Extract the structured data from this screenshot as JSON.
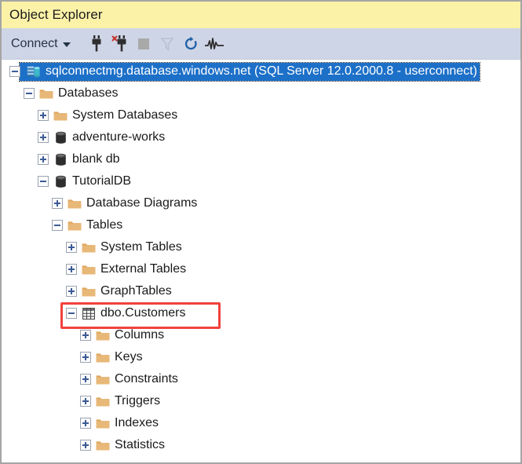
{
  "window": {
    "title": "Object Explorer",
    "border_color": "#a5a5a5",
    "title_bar_color": "#fbf2a8",
    "toolbar_color": "#ced5e6",
    "selection_color": "#1d70c8",
    "highlight_color": "#f2413c"
  },
  "toolbar": {
    "connect_label": "Connect",
    "items": [
      {
        "name": "connect-dropdown",
        "label": "Connect",
        "icon": "chevron-down-icon"
      },
      {
        "name": "connect-object-explorer-button",
        "label": "Connect",
        "icon": "plug-icon"
      },
      {
        "name": "disconnect-button",
        "label": "Disconnect",
        "icon": "plug-disconnect-icon"
      },
      {
        "name": "stop-button",
        "label": "Stop",
        "icon": "stop-square-icon",
        "disabled": true
      },
      {
        "name": "filter-button",
        "label": "Filter",
        "icon": "funnel-icon",
        "disabled": true
      },
      {
        "name": "refresh-button",
        "label": "Refresh",
        "icon": "refresh-icon"
      },
      {
        "name": "activity-monitor-button",
        "label": "Activity Monitor",
        "icon": "activity-monitor-icon"
      }
    ]
  },
  "tree": {
    "nodes": [
      {
        "label": "sqlconnectmg.database.windows.net (SQL Server 12.0.2000.8 - userconnect)",
        "depth": 0,
        "state": "expanded",
        "icon": "server-icon",
        "selected": true
      },
      {
        "label": "Databases",
        "depth": 1,
        "state": "expanded",
        "icon": "folder-icon",
        "selected": false
      },
      {
        "label": "System Databases",
        "depth": 2,
        "state": "collapsed",
        "icon": "folder-icon",
        "selected": false
      },
      {
        "label": "adventure-works",
        "depth": 2,
        "state": "collapsed",
        "icon": "database-icon",
        "selected": false
      },
      {
        "label": "blank db",
        "depth": 2,
        "state": "collapsed",
        "icon": "database-icon",
        "selected": false
      },
      {
        "label": "TutorialDB",
        "depth": 2,
        "state": "expanded",
        "icon": "database-icon",
        "selected": false
      },
      {
        "label": "Database Diagrams",
        "depth": 3,
        "state": "collapsed",
        "icon": "folder-icon",
        "selected": false
      },
      {
        "label": "Tables",
        "depth": 3,
        "state": "expanded",
        "icon": "folder-icon",
        "selected": false
      },
      {
        "label": "System Tables",
        "depth": 4,
        "state": "collapsed",
        "icon": "folder-icon",
        "selected": false
      },
      {
        "label": "External Tables",
        "depth": 4,
        "state": "collapsed",
        "icon": "folder-icon",
        "selected": false
      },
      {
        "label": "GraphTables",
        "depth": 4,
        "state": "collapsed",
        "icon": "folder-icon",
        "selected": false
      },
      {
        "label": "dbo.Customers",
        "depth": 4,
        "state": "expanded",
        "icon": "table-icon",
        "selected": false,
        "highlighted": true
      },
      {
        "label": "Columns",
        "depth": 5,
        "state": "collapsed",
        "icon": "folder-icon",
        "selected": false
      },
      {
        "label": "Keys",
        "depth": 5,
        "state": "collapsed",
        "icon": "folder-icon",
        "selected": false
      },
      {
        "label": "Constraints",
        "depth": 5,
        "state": "collapsed",
        "icon": "folder-icon",
        "selected": false
      },
      {
        "label": "Triggers",
        "depth": 5,
        "state": "collapsed",
        "icon": "folder-icon",
        "selected": false
      },
      {
        "label": "Indexes",
        "depth": 5,
        "state": "collapsed",
        "icon": "folder-icon",
        "selected": false
      },
      {
        "label": "Statistics",
        "depth": 5,
        "state": "collapsed",
        "icon": "folder-icon",
        "selected": false
      }
    ]
  }
}
